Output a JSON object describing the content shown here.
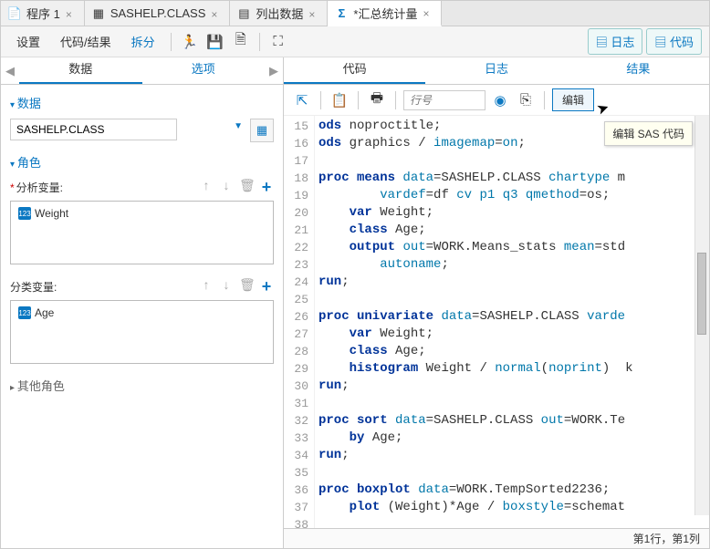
{
  "tabs": [
    {
      "label": "程序 1",
      "active": false
    },
    {
      "label": "SASHELP.CLASS",
      "active": false
    },
    {
      "label": "列出数据",
      "active": false
    },
    {
      "label": "*汇总统计量",
      "active": true
    }
  ],
  "toolbar": {
    "settings": "设置",
    "code_results": "代码/结果",
    "split": "拆分",
    "log_btn": "日志",
    "code_btn": "代码"
  },
  "left": {
    "tabs": {
      "data": "数据",
      "options": "选项"
    },
    "data_section": "数据",
    "dataset": "SASHELP.CLASS",
    "roles_section": "角色",
    "analysis_var_label": "分析变量:",
    "analysis_var_item": "Weight",
    "class_var_label": "分类变量:",
    "class_var_item": "Age",
    "other_roles": "其他角色"
  },
  "right": {
    "tabs": {
      "code": "代码",
      "log": "日志",
      "results": "结果"
    },
    "line_placeholder": "行号",
    "edit": "编辑",
    "tooltip": "编辑 SAS 代码",
    "status": "第1行，第1列"
  },
  "code": {
    "start": 15,
    "lines": [
      [
        {
          "t": "kw",
          "v": "ods"
        },
        {
          "t": "",
          "v": " noproctitle;"
        }
      ],
      [
        {
          "t": "kw",
          "v": "ods"
        },
        {
          "t": "",
          "v": " graphics / "
        },
        {
          "t": "opt",
          "v": "imagemap"
        },
        {
          "t": "",
          "v": "="
        },
        {
          "t": "opt",
          "v": "on"
        },
        {
          "t": "",
          "v": ";"
        }
      ],
      [],
      [
        {
          "t": "kw",
          "v": "proc means"
        },
        {
          "t": "",
          "v": " "
        },
        {
          "t": "opt",
          "v": "data"
        },
        {
          "t": "",
          "v": "=SASHELP.CLASS "
        },
        {
          "t": "opt",
          "v": "chartype"
        },
        {
          "t": "",
          "v": " m"
        }
      ],
      [
        {
          "t": "",
          "v": "        "
        },
        {
          "t": "opt",
          "v": "vardef"
        },
        {
          "t": "",
          "v": "=df "
        },
        {
          "t": "opt",
          "v": "cv"
        },
        {
          "t": "",
          "v": " "
        },
        {
          "t": "opt",
          "v": "p1"
        },
        {
          "t": "",
          "v": " "
        },
        {
          "t": "opt",
          "v": "q3"
        },
        {
          "t": "",
          "v": " "
        },
        {
          "t": "opt",
          "v": "qmethod"
        },
        {
          "t": "",
          "v": "=os;"
        }
      ],
      [
        {
          "t": "",
          "v": "    "
        },
        {
          "t": "kw",
          "v": "var"
        },
        {
          "t": "",
          "v": " Weight;"
        }
      ],
      [
        {
          "t": "",
          "v": "    "
        },
        {
          "t": "kw",
          "v": "class"
        },
        {
          "t": "",
          "v": " Age;"
        }
      ],
      [
        {
          "t": "",
          "v": "    "
        },
        {
          "t": "kw",
          "v": "output"
        },
        {
          "t": "",
          "v": " "
        },
        {
          "t": "opt",
          "v": "out"
        },
        {
          "t": "",
          "v": "=WORK.Means_stats "
        },
        {
          "t": "opt",
          "v": "mean"
        },
        {
          "t": "",
          "v": "=std"
        }
      ],
      [
        {
          "t": "",
          "v": "        "
        },
        {
          "t": "opt",
          "v": "autoname"
        },
        {
          "t": "",
          "v": ";"
        }
      ],
      [
        {
          "t": "kw",
          "v": "run"
        },
        {
          "t": "",
          "v": ";"
        }
      ],
      [],
      [
        {
          "t": "kw",
          "v": "proc univariate"
        },
        {
          "t": "",
          "v": " "
        },
        {
          "t": "opt",
          "v": "data"
        },
        {
          "t": "",
          "v": "=SASHELP.CLASS "
        },
        {
          "t": "opt",
          "v": "varde"
        }
      ],
      [
        {
          "t": "",
          "v": "    "
        },
        {
          "t": "kw",
          "v": "var"
        },
        {
          "t": "",
          "v": " Weight;"
        }
      ],
      [
        {
          "t": "",
          "v": "    "
        },
        {
          "t": "kw",
          "v": "class"
        },
        {
          "t": "",
          "v": " Age;"
        }
      ],
      [
        {
          "t": "",
          "v": "    "
        },
        {
          "t": "kw",
          "v": "histogram"
        },
        {
          "t": "",
          "v": " Weight / "
        },
        {
          "t": "opt",
          "v": "normal"
        },
        {
          "t": "",
          "v": "("
        },
        {
          "t": "opt",
          "v": "noprint"
        },
        {
          "t": "",
          "v": ")  k"
        }
      ],
      [
        {
          "t": "kw",
          "v": "run"
        },
        {
          "t": "",
          "v": ";"
        }
      ],
      [],
      [
        {
          "t": "kw",
          "v": "proc sort"
        },
        {
          "t": "",
          "v": " "
        },
        {
          "t": "opt",
          "v": "data"
        },
        {
          "t": "",
          "v": "=SASHELP.CLASS "
        },
        {
          "t": "opt",
          "v": "out"
        },
        {
          "t": "",
          "v": "=WORK.Te"
        }
      ],
      [
        {
          "t": "",
          "v": "    "
        },
        {
          "t": "kw",
          "v": "by"
        },
        {
          "t": "",
          "v": " Age;"
        }
      ],
      [
        {
          "t": "kw",
          "v": "run"
        },
        {
          "t": "",
          "v": ";"
        }
      ],
      [],
      [
        {
          "t": "kw",
          "v": "proc boxplot"
        },
        {
          "t": "",
          "v": " "
        },
        {
          "t": "opt",
          "v": "data"
        },
        {
          "t": "",
          "v": "=WORK.TempSorted2236;"
        }
      ],
      [
        {
          "t": "",
          "v": "    "
        },
        {
          "t": "kw",
          "v": "plot"
        },
        {
          "t": "",
          "v": " (Weight)*Age / "
        },
        {
          "t": "opt",
          "v": "boxstyle"
        },
        {
          "t": "",
          "v": "=schemat"
        }
      ],
      []
    ]
  }
}
